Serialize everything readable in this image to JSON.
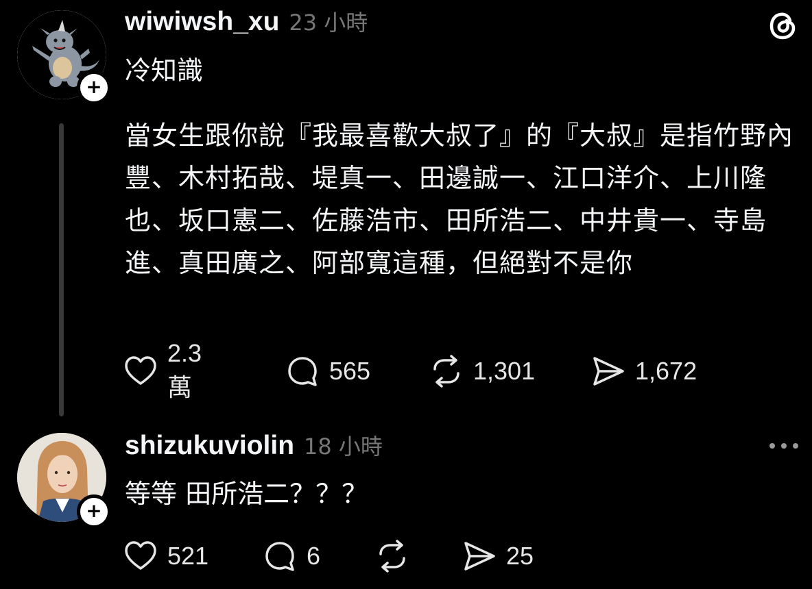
{
  "posts": [
    {
      "username": "wiwiwsh_xu",
      "time": "23 小時",
      "intro": "冷知識",
      "body": "當女生跟你說『我最喜歡大叔了』的『大叔』是指竹野內豐、木村拓哉、堤真一、田邊誠一、江口洋介、上川隆也、坂口憲二、佐藤浩市、田所浩二、中井貴一、寺島進、真田廣之、阿部寬這種，但絕對不是你",
      "follow_label": "+",
      "likes": "2.3萬",
      "comments": "565",
      "reposts": "1,301",
      "shares": "1,672"
    },
    {
      "username": "shizukuviolin",
      "time": "18 小時",
      "body": "等等 田所浩二？？？",
      "follow_label": "+",
      "likes": "521",
      "comments": "6",
      "reposts": "",
      "shares": "25"
    }
  ],
  "icons": {
    "top_right": "threads-logo-icon",
    "more": "more-options-icon",
    "like": "heart-icon",
    "comment": "comment-bubble-icon",
    "repost": "repost-icon",
    "share": "send-icon"
  },
  "colors": {
    "background": "#000000",
    "text": "#f3f5f7",
    "secondary": "#777777",
    "thread_line": "#383838"
  }
}
